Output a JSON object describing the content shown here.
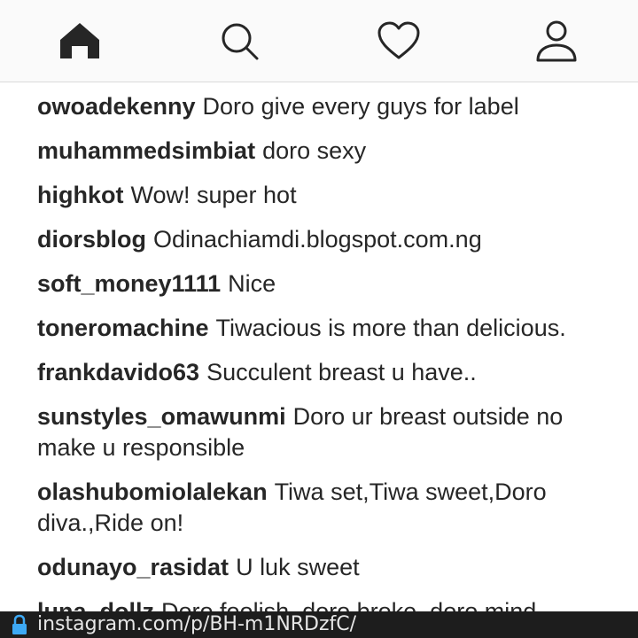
{
  "nav": {
    "items": [
      {
        "icon": "home-icon",
        "active": true
      },
      {
        "icon": "search-icon",
        "active": false
      },
      {
        "icon": "heart-icon",
        "active": false
      },
      {
        "icon": "profile-icon",
        "active": false
      }
    ]
  },
  "comments": [
    {
      "username": "owoadekenny",
      "text": "Doro give every guys for label"
    },
    {
      "username": "muhammedsimbiat",
      "text": "doro sexy"
    },
    {
      "username": "highkot",
      "text": "Wow! super hot"
    },
    {
      "username": "diorsblog",
      "text": "Odinachiamdi.blogspot.com.ng"
    },
    {
      "username": "soft_money1111",
      "text": "Nice"
    },
    {
      "username": "toneromachine",
      "text": "Tiwacious is more than delicious."
    },
    {
      "username": "frankdavido63",
      "text": "Succulent breast u have.."
    },
    {
      "username": "sunstyles_omawunmi",
      "text": "Doro ur breast outside no make u responsible"
    },
    {
      "username": "olashubomiolalekan",
      "text": "Tiwa set,Tiwa sweet,Doro diva.,Ride on!"
    },
    {
      "username": "odunayo_rasidat",
      "text": "U luk sweet"
    },
    {
      "username": "luna_dollz",
      "text": "Doro foolish, doro broke, doro mind"
    }
  ],
  "browser": {
    "url": "instagram.com/p/BH-m1NRDzfC/",
    "lock_icon": "lock-icon",
    "bar_color": "#1d1d1d"
  }
}
